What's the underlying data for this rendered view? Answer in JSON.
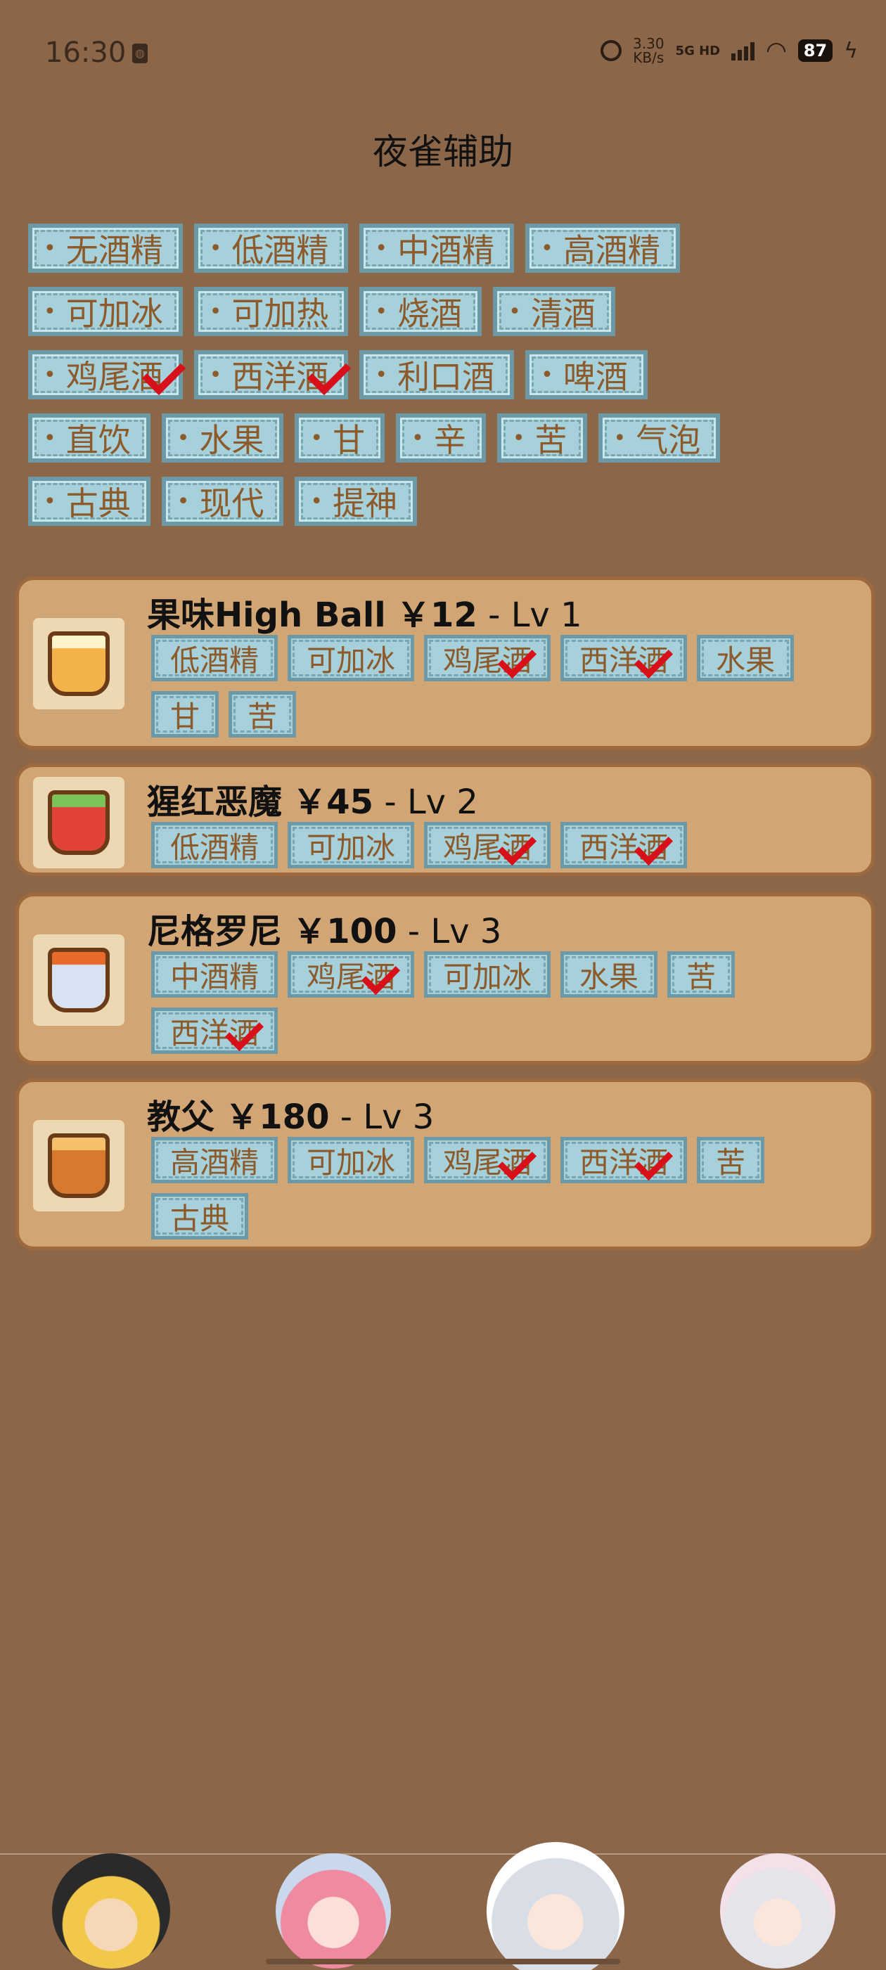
{
  "status_bar": {
    "time": "16:30",
    "net_speed": "3.30\nKB/s",
    "network": "5G HD",
    "battery": "87"
  },
  "title": "夜雀辅助",
  "filters": [
    [
      {
        "label": "无酒精",
        "checked": false
      },
      {
        "label": "低酒精",
        "checked": false
      },
      {
        "label": "中酒精",
        "checked": false
      },
      {
        "label": "高酒精",
        "checked": false
      }
    ],
    [
      {
        "label": "可加冰",
        "checked": false
      },
      {
        "label": "可加热",
        "checked": false
      },
      {
        "label": "烧酒",
        "checked": false
      },
      {
        "label": "清酒",
        "checked": false
      }
    ],
    [
      {
        "label": "鸡尾酒",
        "checked": true
      },
      {
        "label": "西洋酒",
        "checked": true
      },
      {
        "label": "利口酒",
        "checked": false
      },
      {
        "label": "啤酒",
        "checked": false
      }
    ],
    [
      {
        "label": "直饮",
        "checked": false
      },
      {
        "label": "水果",
        "checked": false
      },
      {
        "label": "甘",
        "checked": false
      },
      {
        "label": "辛",
        "checked": false
      },
      {
        "label": "苦",
        "checked": false
      },
      {
        "label": "气泡",
        "checked": false
      }
    ],
    [
      {
        "label": "古典",
        "checked": false
      },
      {
        "label": "现代",
        "checked": false
      },
      {
        "label": "提神",
        "checked": false
      }
    ]
  ],
  "bullet": "•",
  "drinks": [
    {
      "name": "果味High Ball",
      "price": "￥12",
      "level": "- Lv 1",
      "icon": "fruit-highball-icon",
      "tags": [
        {
          "label": "低酒精",
          "checked": false
        },
        {
          "label": "可加冰",
          "checked": false
        },
        {
          "label": "鸡尾酒",
          "checked": true
        },
        {
          "label": "西洋酒",
          "checked": true
        },
        {
          "label": "水果",
          "checked": false
        },
        {
          "label": "甘",
          "checked": false
        },
        {
          "label": "苦",
          "checked": false
        }
      ]
    },
    {
      "name": "猩红恶魔",
      "price": "￥45",
      "level": "- Lv 2",
      "icon": "scarlet-devil-icon",
      "tags": [
        {
          "label": "低酒精",
          "checked": false
        },
        {
          "label": "可加冰",
          "checked": false
        },
        {
          "label": "鸡尾酒",
          "checked": true
        },
        {
          "label": "西洋酒",
          "checked": true
        }
      ]
    },
    {
      "name": "尼格罗尼",
      "price": "￥100",
      "level": "- Lv 3",
      "icon": "negroni-icon",
      "tags": [
        {
          "label": "中酒精",
          "checked": false
        },
        {
          "label": "鸡尾酒",
          "checked": true
        },
        {
          "label": "可加冰",
          "checked": false
        },
        {
          "label": "水果",
          "checked": false
        },
        {
          "label": "苦",
          "checked": false
        },
        {
          "label": "西洋酒",
          "checked": true
        }
      ]
    },
    {
      "name": "教父",
      "price": "￥180",
      "level": "- Lv 3",
      "icon": "godfather-icon",
      "tags": [
        {
          "label": "高酒精",
          "checked": false
        },
        {
          "label": "可加冰",
          "checked": false
        },
        {
          "label": "鸡尾酒",
          "checked": true
        },
        {
          "label": "西洋酒",
          "checked": true
        },
        {
          "label": "苦",
          "checked": false
        },
        {
          "label": "古典",
          "checked": false
        }
      ]
    }
  ],
  "nav": [
    "marisa-avatar-icon",
    "yuyuko-avatar-icon",
    "sakuya-avatar-icon",
    "youmu-avatar-icon"
  ]
}
